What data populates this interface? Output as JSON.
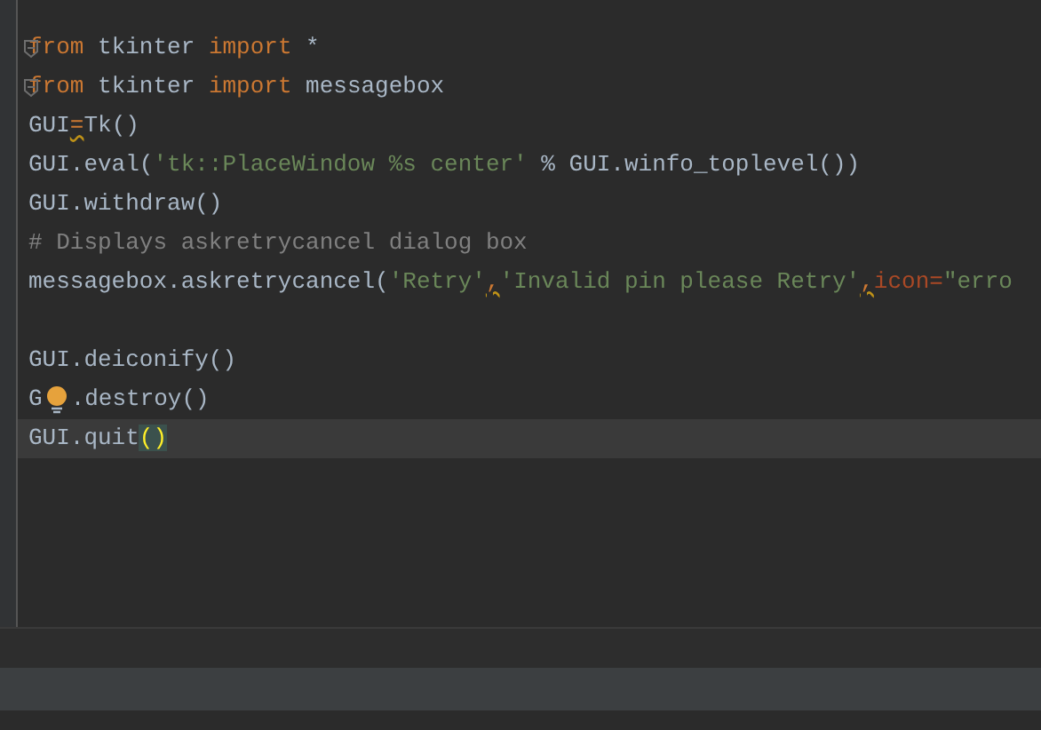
{
  "editor": {
    "lines": [
      {
        "kind": "code",
        "fold": true,
        "current": false,
        "tokens": [
          {
            "text": "from",
            "kind": "keyword"
          },
          {
            "text": " tkinter ",
            "kind": "plain"
          },
          {
            "text": "import",
            "kind": "keyword"
          },
          {
            "text": " *",
            "kind": "plain"
          }
        ]
      },
      {
        "kind": "code",
        "fold": true,
        "current": false,
        "tokens": [
          {
            "text": "from",
            "kind": "keyword"
          },
          {
            "text": " tkinter ",
            "kind": "plain"
          },
          {
            "text": "import",
            "kind": "keyword"
          },
          {
            "text": " messagebox",
            "kind": "plain"
          }
        ]
      },
      {
        "kind": "code",
        "fold": false,
        "current": false,
        "tokens": [
          {
            "text": "GUI",
            "kind": "plain"
          },
          {
            "text": "=",
            "kind": "warn"
          },
          {
            "text": "Tk()",
            "kind": "plain"
          }
        ]
      },
      {
        "kind": "code",
        "fold": false,
        "current": false,
        "tokens": [
          {
            "text": "GUI.eval(",
            "kind": "plain"
          },
          {
            "text": "'tk::PlaceWindow %s center'",
            "kind": "string"
          },
          {
            "text": " % GUI.winfo_toplevel())",
            "kind": "plain"
          }
        ]
      },
      {
        "kind": "code",
        "fold": false,
        "current": false,
        "tokens": [
          {
            "text": "GUI.withdraw()",
            "kind": "plain"
          }
        ]
      },
      {
        "kind": "code",
        "fold": false,
        "current": false,
        "tokens": [
          {
            "text": "# Displays askretrycancel dialog box",
            "kind": "comment"
          }
        ]
      },
      {
        "kind": "code",
        "fold": false,
        "current": false,
        "tokens": [
          {
            "text": "messagebox.askretrycancel(",
            "kind": "plain"
          },
          {
            "text": "'Retry'",
            "kind": "string"
          },
          {
            "text": ",",
            "kind": "warn"
          },
          {
            "text": "'Invalid pin please Retry'",
            "kind": "string"
          },
          {
            "text": ",",
            "kind": "warn"
          },
          {
            "text": "icon=",
            "kind": "param"
          },
          {
            "text": "\"erro",
            "kind": "string"
          }
        ]
      },
      {
        "kind": "blank"
      },
      {
        "kind": "code",
        "fold": false,
        "current": false,
        "tokens": [
          {
            "text": "GUI.deiconify()",
            "kind": "plain"
          }
        ]
      },
      {
        "kind": "code",
        "fold": false,
        "current": false,
        "tokens": [
          {
            "text": "G",
            "kind": "plain"
          },
          {
            "kind": "bulb"
          },
          {
            "text": ".destroy()",
            "kind": "plain"
          }
        ]
      },
      {
        "kind": "code",
        "fold": false,
        "current": true,
        "tokens": [
          {
            "text": "GUI.quit",
            "kind": "plain"
          },
          {
            "text": "()",
            "kind": "match"
          }
        ]
      }
    ]
  }
}
